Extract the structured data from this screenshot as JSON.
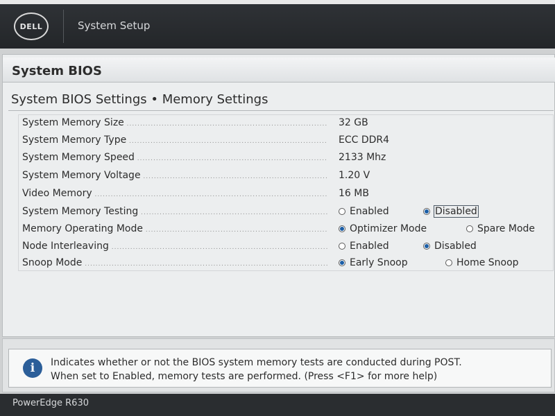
{
  "header": {
    "logo_text": "DELL",
    "app_title": "System Setup"
  },
  "panel": {
    "title": "System BIOS",
    "breadcrumb": "System BIOS Settings • Memory Settings"
  },
  "settings": {
    "memory_size": {
      "label": "System Memory Size",
      "value": "32 GB"
    },
    "memory_type": {
      "label": "System Memory Type",
      "value": "ECC DDR4"
    },
    "memory_speed": {
      "label": "System Memory Speed",
      "value": "2133 Mhz"
    },
    "memory_voltage": {
      "label": "System Memory Voltage",
      "value": "1.20 V"
    },
    "video_memory": {
      "label": "Video Memory",
      "value": "16 MB"
    },
    "memory_testing": {
      "label": "System Memory Testing",
      "options": [
        "Enabled",
        "Disabled"
      ],
      "selected": "Disabled"
    },
    "operating_mode": {
      "label": "Memory Operating Mode",
      "options": [
        "Optimizer Mode",
        "Spare Mode"
      ],
      "selected": "Optimizer Mode"
    },
    "node_interleaving": {
      "label": "Node Interleaving",
      "options": [
        "Enabled",
        "Disabled"
      ],
      "selected": "Disabled"
    },
    "snoop_mode": {
      "label": "Snoop Mode",
      "options": [
        "Early Snoop",
        "Home Snoop"
      ],
      "selected": "Early Snoop"
    }
  },
  "help": {
    "icon": "info-icon",
    "line1": "Indicates whether or not the BIOS system memory tests are conducted during POST.",
    "line2": "When set to Enabled, memory tests are performed. (Press <F1> for more help)"
  },
  "footer": {
    "model": "PowerEdge R630"
  },
  "colors": {
    "header_bg": "#2f3236",
    "panel_bg": "#eceeef",
    "radio_selected": "#1b5ea6",
    "info_icon": "#2b5e99"
  }
}
